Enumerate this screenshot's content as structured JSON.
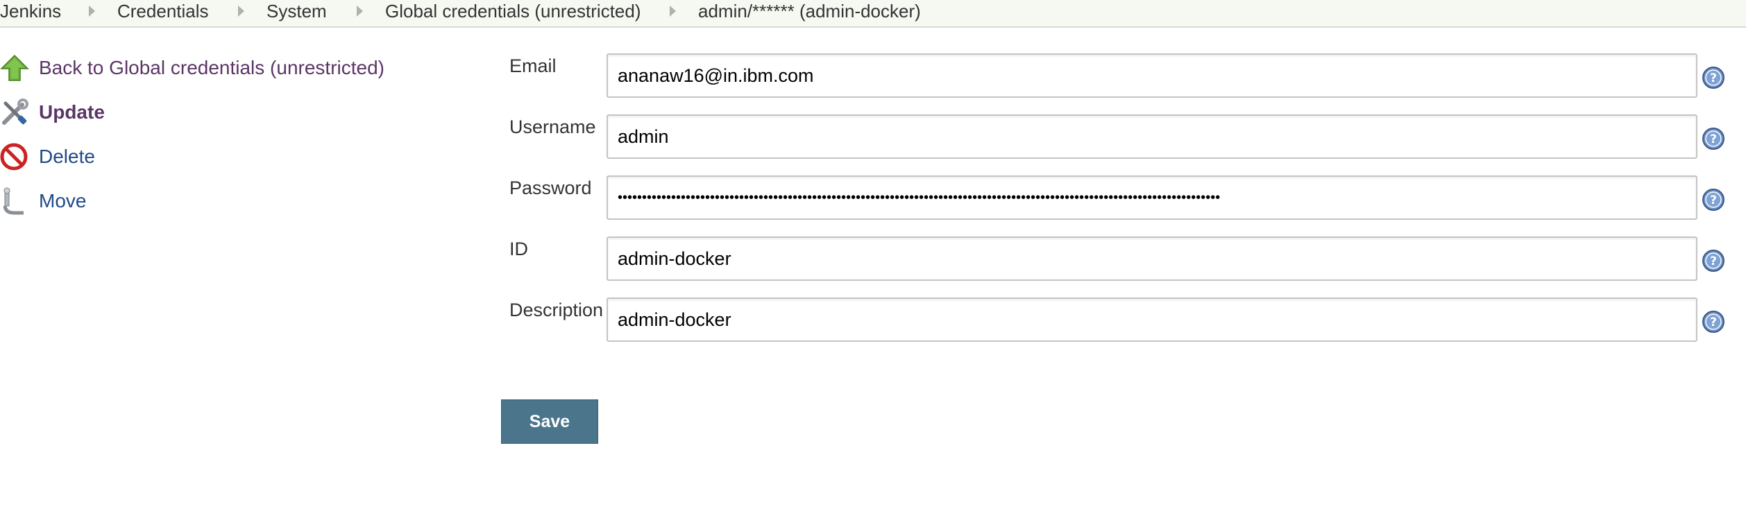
{
  "breadcrumb": {
    "items": [
      "Jenkins",
      "Credentials",
      "System",
      "Global credentials (unrestricted)",
      "admin/****** (admin-docker)"
    ]
  },
  "sidebar": {
    "items": [
      {
        "label": "Back to Global credentials (unrestricted)",
        "icon": "up-arrow-icon"
      },
      {
        "label": "Update",
        "icon": "tools-icon"
      },
      {
        "label": "Delete",
        "icon": "no-entry-icon"
      },
      {
        "label": "Move",
        "icon": "move-icon"
      }
    ]
  },
  "form": {
    "fields": [
      {
        "label": "Email",
        "value": "ananaw16@in.ibm.com"
      },
      {
        "label": "Username",
        "value": "admin"
      },
      {
        "label": "Password",
        "value": "••••••••••••••••••••••••••••••••••••••••••••••••••••••••••••••••••••••••••••••••••••••••••••••••••••••••••••••••••••••••••••"
      },
      {
        "label": "ID",
        "value": "admin-docker"
      },
      {
        "label": "Description",
        "value": "admin-docker"
      }
    ],
    "save_label": "Save"
  },
  "colors": {
    "link": "#204a87",
    "visited_link": "#5c3566",
    "save_button": "#4b758b",
    "breadcrumb_bg": "#f6f8f2"
  }
}
